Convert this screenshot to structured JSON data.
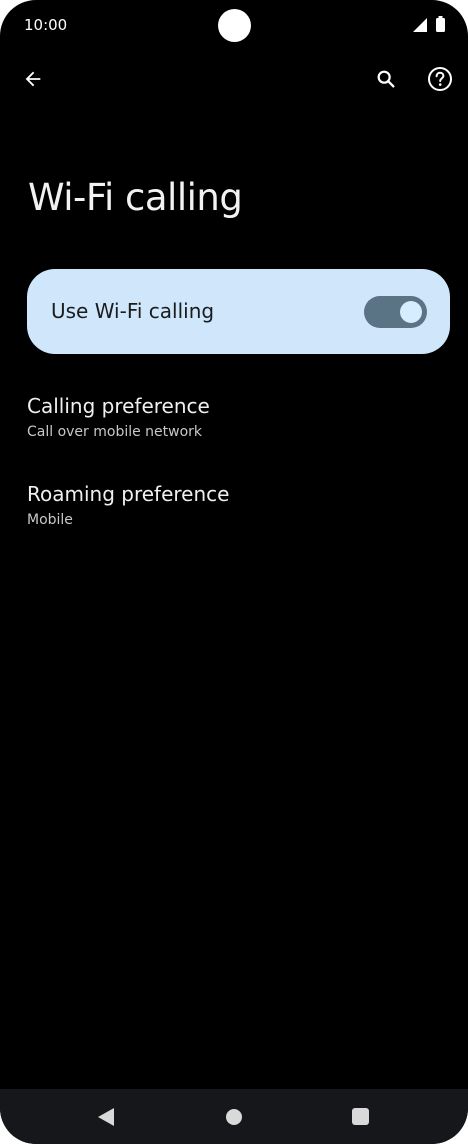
{
  "status_bar": {
    "time": "10:00"
  },
  "header": {
    "back_icon": "arrow-back-icon",
    "search_icon": "search-icon",
    "help_icon": "help-circle-icon"
  },
  "page": {
    "title": "Wi-Fi calling"
  },
  "main_switch": {
    "label": "Use Wi-Fi calling",
    "enabled": true
  },
  "preferences": [
    {
      "title": "Calling preference",
      "summary": "Call over mobile network"
    },
    {
      "title": "Roaming preference",
      "summary": "Mobile"
    }
  ],
  "colors": {
    "switch_bg": "#cfe6fb",
    "toggle_track": "#5a7385",
    "background": "#000000"
  }
}
